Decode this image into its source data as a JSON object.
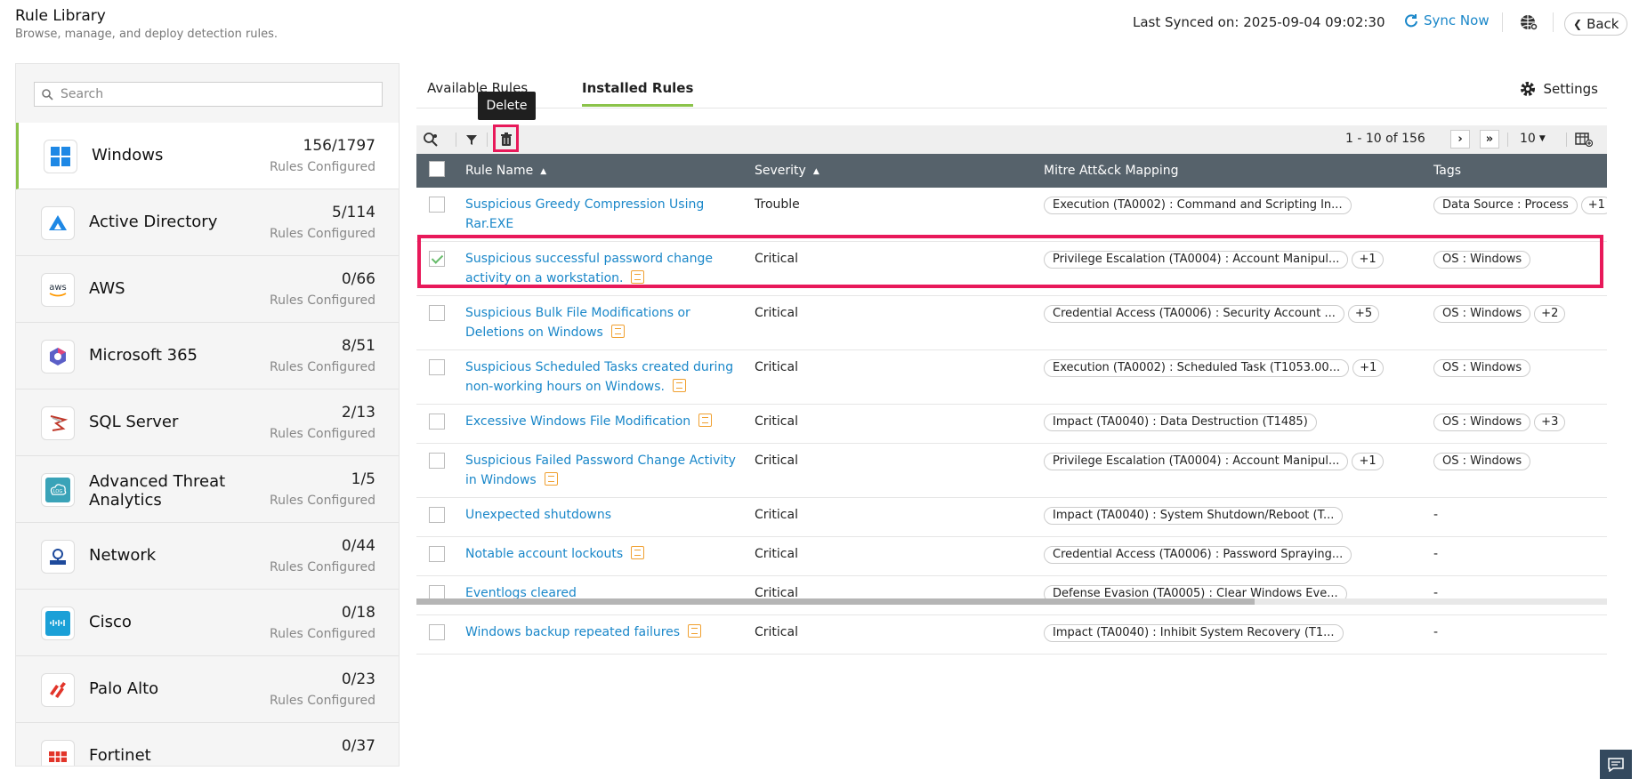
{
  "header": {
    "title": "Rule Library",
    "subtitle": "Browse, manage, and deploy detection rules.",
    "last_synced": "Last Synced on: 2025-09-04 09:02:30",
    "sync_now": "Sync Now",
    "back": "Back"
  },
  "sidebar": {
    "search_placeholder": "Search",
    "configured_label": "Rules Configured",
    "items": [
      {
        "name": "Windows",
        "count": "156/1797",
        "icon": "windows-icon",
        "active": true
      },
      {
        "name": "Active Directory",
        "count": "5/114",
        "icon": "active-directory-icon"
      },
      {
        "name": "AWS",
        "count": "0/66",
        "icon": "aws-icon"
      },
      {
        "name": "Microsoft 365",
        "count": "8/51",
        "icon": "microsoft-365-icon"
      },
      {
        "name": "SQL Server",
        "count": "2/13",
        "icon": "sql-server-icon"
      },
      {
        "name": "Advanced Threat Analytics",
        "count": "1/5",
        "icon": "ata-log-icon"
      },
      {
        "name": "Network",
        "count": "0/44",
        "icon": "network-icon"
      },
      {
        "name": "Cisco",
        "count": "0/18",
        "icon": "cisco-icon"
      },
      {
        "name": "Palo Alto",
        "count": "0/23",
        "icon": "palo-alto-icon"
      },
      {
        "name": "Fortinet",
        "count": "0/37",
        "icon": "fortinet-icon"
      }
    ]
  },
  "tabs": {
    "available": "Available Rules",
    "installed": "Installed Rules",
    "settings": "Settings"
  },
  "toolbar": {
    "tooltip": "Delete",
    "pagination": "1 - 10 of 156",
    "page_size": "10"
  },
  "table": {
    "columns": [
      "Rule Name",
      "Severity",
      "Mitre Att&ck Mapping",
      "Tags"
    ],
    "rows": [
      {
        "name": "Suspicious Greedy Compression Using Rar.EXE",
        "severity": "Trouble",
        "mitre": "Execution (TA0002) : Command and Scripting In...",
        "mitre_more": "",
        "tag": "Data Source : Process",
        "tag_more": "+1",
        "checked": false,
        "icon": false
      },
      {
        "name": "Suspicious successful password change activity on a workstation.",
        "severity": "Critical",
        "mitre": "Privilege Escalation (TA0004) : Account Manipul...",
        "mitre_more": "+1",
        "tag": "OS : Windows",
        "tag_more": "",
        "checked": true,
        "icon": true
      },
      {
        "name": "Suspicious Bulk File Modifications or Deletions on Windows",
        "severity": "Critical",
        "mitre": "Credential Access (TA0006) : Security Account ...",
        "mitre_more": "+5",
        "tag": "OS : Windows",
        "tag_more": "+2",
        "checked": false,
        "icon": true
      },
      {
        "name": "Suspicious Scheduled Tasks created during non-working hours on Windows.",
        "severity": "Critical",
        "mitre": "Execution (TA0002) : Scheduled Task (T1053.00...",
        "mitre_more": "+1",
        "tag": "OS : Windows",
        "tag_more": "",
        "checked": false,
        "icon": true
      },
      {
        "name": "Excessive Windows File Modification",
        "severity": "Critical",
        "mitre": "Impact (TA0040) : Data Destruction (T1485)",
        "mitre_more": "",
        "tag": "OS : Windows",
        "tag_more": "+3",
        "checked": false,
        "icon": true
      },
      {
        "name": "Suspicious Failed Password Change Activity in Windows",
        "severity": "Critical",
        "mitre": "Privilege Escalation (TA0004) : Account Manipul...",
        "mitre_more": "+1",
        "tag": "OS : Windows",
        "tag_more": "",
        "checked": false,
        "icon": true
      },
      {
        "name": "Unexpected shutdowns",
        "severity": "Critical",
        "mitre": "Impact (TA0040) : System Shutdown/Reboot (T...",
        "mitre_more": "",
        "tag": "-",
        "tag_more": "",
        "checked": false,
        "icon": false
      },
      {
        "name": "Notable account lockouts",
        "severity": "Critical",
        "mitre": "Credential Access (TA0006) : Password Spraying...",
        "mitre_more": "",
        "tag": "-",
        "tag_more": "",
        "checked": false,
        "icon": true
      },
      {
        "name": "Eventlogs cleared",
        "severity": "Critical",
        "mitre": "Defense Evasion (TA0005) : Clear Windows Eve...",
        "mitre_more": "",
        "tag": "-",
        "tag_more": "",
        "checked": false,
        "icon": false
      },
      {
        "name": "Windows backup repeated failures",
        "severity": "Critical",
        "mitre": "Impact (TA0040) : Inhibit System Recovery (T1...",
        "mitre_more": "",
        "tag": "-",
        "tag_more": "",
        "checked": false,
        "icon": true
      }
    ]
  },
  "colors": {
    "accent": "#8bc34a",
    "link": "#1a87c9",
    "highlight": "#e8195a",
    "table_header": "#56626b"
  }
}
